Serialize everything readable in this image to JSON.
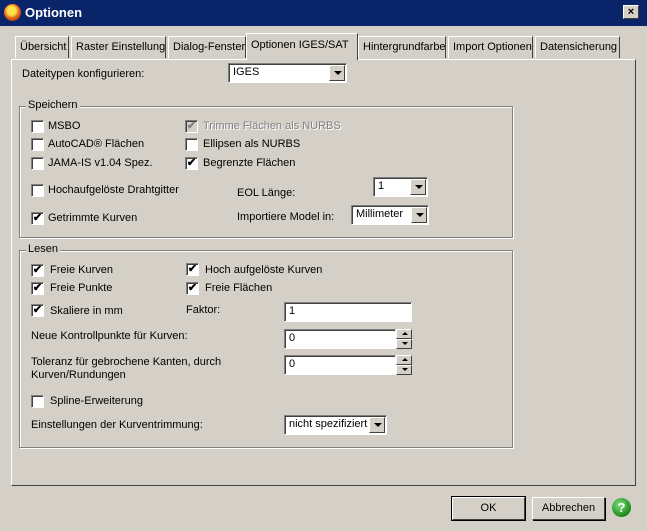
{
  "window": {
    "title": "Optionen",
    "close_glyph": "×",
    "icon": "app-flame-icon"
  },
  "tabs": [
    {
      "label": "Übersicht"
    },
    {
      "label": "Raster Einstellung"
    },
    {
      "label": "Dialog-Fenster"
    },
    {
      "label": "Optionen IGES/SAT",
      "active": true
    },
    {
      "label": "Hintergrundfarbe"
    },
    {
      "label": "Import Optionen"
    },
    {
      "label": "Datensicherung"
    }
  ],
  "filetype": {
    "label": "Dateitypen konfigurieren:",
    "value": "IGES"
  },
  "save": {
    "legend": "Speichern",
    "checks": {
      "msbo": {
        "label": "MSBO",
        "checked": false
      },
      "autocad": {
        "label": "AutoCAD® Flächen",
        "checked": false
      },
      "jama": {
        "label": "JAMA-IS v1.04 Spez.",
        "checked": false
      },
      "hires": {
        "label": "Hochaufgelöste Drahtgitter",
        "checked": false
      },
      "trimmed": {
        "label": "Getrimmte Kurven",
        "checked": true,
        "mark": "✔"
      },
      "trim_nurbs": {
        "label": "Trimme Flächen als NURBS",
        "checked": true,
        "disabled": true,
        "mark": "✔"
      },
      "ellipse": {
        "label": "Ellipsen als NURBS",
        "checked": false
      },
      "bounded": {
        "label": "Begrenzte Flächen",
        "checked": true,
        "mark": "✔"
      }
    },
    "eol": {
      "label": "EOL Länge:",
      "value": "1"
    },
    "model": {
      "label": "Importiere Model in:",
      "value": "Millimeter"
    }
  },
  "read": {
    "legend": "Lesen",
    "checks": {
      "free_curves": {
        "label": "Freie Kurven",
        "checked": true,
        "mark": "✔"
      },
      "free_points": {
        "label": "Freie Punkte",
        "checked": true,
        "mark": "✔"
      },
      "scale_mm": {
        "label": "Skaliere in mm",
        "checked": true,
        "mark": "✔"
      },
      "hires_curves": {
        "label": "Hoch aufgelöste Kurven",
        "checked": true,
        "mark": "✔"
      },
      "free_surfaces": {
        "label": "Freie Flächen",
        "checked": true,
        "mark": "✔"
      },
      "spline": {
        "label": "Spline-Erweiterung",
        "checked": false
      }
    },
    "factor": {
      "label": "Faktor:",
      "value": "1"
    },
    "ctrl_points": {
      "label": "Neue Kontrollpunkte für Kurven:",
      "value": "0"
    },
    "tolerance": {
      "label": "Toleranz für gebrochene Kanten, durch Kurven/Rundungen",
      "value": "0"
    },
    "trimming": {
      "label": "Einstellungen der Kurventrimmung:",
      "value": "nicht spezifiziert"
    }
  },
  "footer": {
    "ok_label": "OK",
    "cancel_label": "Abbrechen",
    "help_glyph": "?"
  }
}
